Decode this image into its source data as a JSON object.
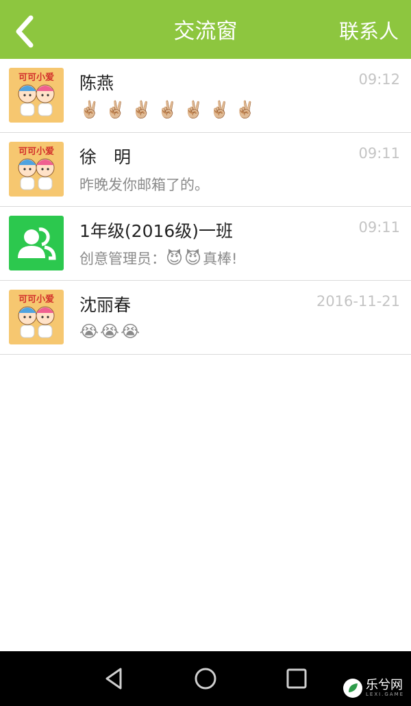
{
  "header": {
    "back_icon": "chevron-left-icon",
    "title": "交流窗",
    "contacts_label": "联系人",
    "bg_color": "#8dc63f"
  },
  "conversations": [
    {
      "name": "陈燕",
      "time": "09:12",
      "avatar": "cartoon-kids-avatar",
      "message_text": "",
      "emojis": [
        "✌🏼",
        "✌🏼",
        "✌🏼",
        "✌🏼",
        "✌🏼",
        "✌🏼",
        "✌🏼"
      ]
    },
    {
      "name": "徐　明",
      "time": "09:11",
      "avatar": "cartoon-kids-avatar",
      "message_text": "昨晚发你邮箱了的。",
      "emojis": []
    },
    {
      "name": "1年级(2016级)一班",
      "time": "09:11",
      "avatar": "group-avatar",
      "message_prefix": "创意管理员：",
      "emojis": [
        "😈",
        "😈"
      ],
      "message_suffix": "真棒!"
    },
    {
      "name": "沈丽春",
      "time": "2016-11-21",
      "avatar": "cartoon-kids-avatar",
      "message_text": "",
      "emojis": [
        "😭",
        "😭",
        "😭"
      ]
    }
  ],
  "navbar": {
    "back_icon": "triangle-back-icon",
    "home_icon": "circle-home-icon",
    "recents_icon": "square-recents-icon"
  },
  "watermark": {
    "text": "乐兮网",
    "sub": "LEXI.GAME"
  }
}
